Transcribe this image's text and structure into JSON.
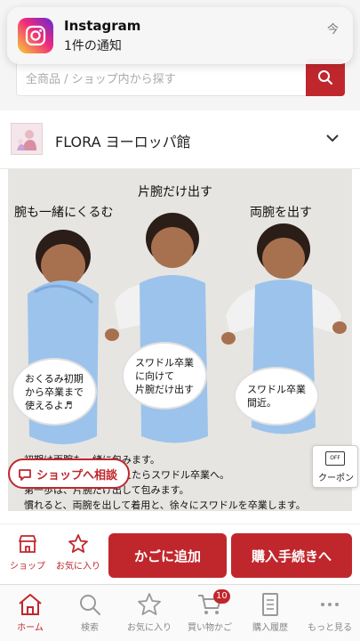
{
  "notification": {
    "app": "Instagram",
    "body": "1件の通知",
    "time": "今"
  },
  "search": {
    "placeholder": "全商品 / ショップ内から探す"
  },
  "shop": {
    "name": "FLORA ヨーロッパ館"
  },
  "product_image": {
    "labels": {
      "left": "腕も一緒にくるむ",
      "middle": "片腕だけ出す",
      "right": "両腕を出す"
    },
    "bubbles": {
      "left": "おくるみ初期\nから卒業まで\n使えるよ♬",
      "middle": "スワドル卒業\nに向けて\n片腕だけ出す",
      "right": "スワドル卒業\n間近。"
    },
    "description": [
      "初期は両腕も一緒に包みます。",
      "赤ちゃんが寝返りを覚えたらスワドル卒業へ。",
      "第一歩は、片腕だけ出して包みます。",
      "慣れると、両腕を出して着用と、徐々にスワドルを卒業します。"
    ]
  },
  "consult_button": "ショップへ相談",
  "coupon": {
    "tag": "OFF",
    "label": "クーポン"
  },
  "actions": {
    "shop": "ショップ",
    "favorite": "お気に入り",
    "add_to_cart": "かごに追加",
    "checkout": "購入手続きへ"
  },
  "tabs": {
    "home": "ホーム",
    "search": "検索",
    "favorites": "お気に入り",
    "cart": "買い物かご",
    "cart_count": "10",
    "history": "購入履歴",
    "more": "もっと見る"
  },
  "colors": {
    "accent": "#c0272d",
    "swaddle": "#9cc3ec"
  }
}
